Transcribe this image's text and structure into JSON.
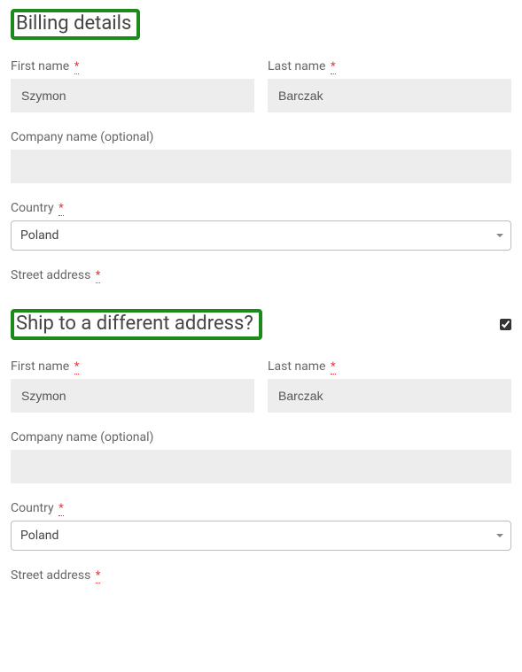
{
  "billing": {
    "heading": "Billing details",
    "first_name_label": "First name",
    "first_name_value": "Szymon",
    "last_name_label": "Last name",
    "last_name_value": "Barczak",
    "company_label": "Company name (optional)",
    "company_value": "",
    "country_label": "Country",
    "country_value": "Poland",
    "street_label": "Street address",
    "required_mark": "*"
  },
  "shipping": {
    "heading": "Ship to a different address?",
    "checked": true,
    "first_name_label": "First name",
    "first_name_value": "Szymon",
    "last_name_label": "Last name",
    "last_name_value": "Barczak",
    "company_label": "Company name (optional)",
    "company_value": "",
    "country_label": "Country",
    "country_value": "Poland",
    "street_label": "Street address",
    "required_mark": "*"
  }
}
